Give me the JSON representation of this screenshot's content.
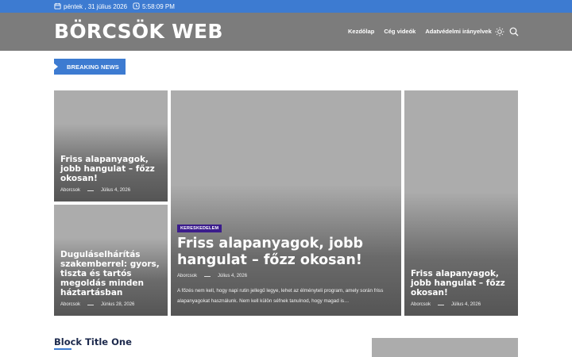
{
  "topbar": {
    "date": "péntek , 31 július 2026",
    "time": "5:58:09 PM",
    "date_icon": "calendar-icon",
    "time_icon": "clock-icon"
  },
  "header": {
    "brand": "BÖRCSÖK WEB",
    "nav": [
      "Kezdőlap",
      "Cég videók",
      "Adatvédelmi irányelvek"
    ],
    "theme_icon": "sun-icon",
    "search_icon": "search-icon"
  },
  "breaking": {
    "label": "BREAKING NEWS"
  },
  "cards": [
    {
      "title": "Friss alapanyagok, jobb hangulat – főzz okosan!",
      "author": "Aborcsok",
      "date": "Július 4, 2026"
    },
    {
      "title": "Duguláselhárítás szakemberrel: gyors, tiszta és tartós megoldás minden háztartásban",
      "author": "Aborcsok",
      "date": "Június 28, 2026"
    },
    {
      "category": "KERESKEDELEM",
      "title": "Friss alapanyagok, jobb hangulat – főzz okosan!",
      "author": "Aborcsok",
      "date": "Július 4, 2026",
      "excerpt": "A főzés nem kell, hogy napi rutin jellegű legye, lehet az élményteli program, amely során friss alapanyagokat használunk. Nem kell külön séfnek tanulnod, hogy magad is…"
    },
    {
      "title": "Friss alapanyagok, jobb hangulat – főzz okosan!",
      "author": "Aborcsok",
      "date": "Július 4, 2026"
    }
  ],
  "block": {
    "title": "Block Title One"
  },
  "colors": {
    "accent": "#3d7bd1",
    "header_bg": "#7c7c7c",
    "category_bg": "#3b1c8c",
    "title_dark": "#1d2a4d"
  }
}
